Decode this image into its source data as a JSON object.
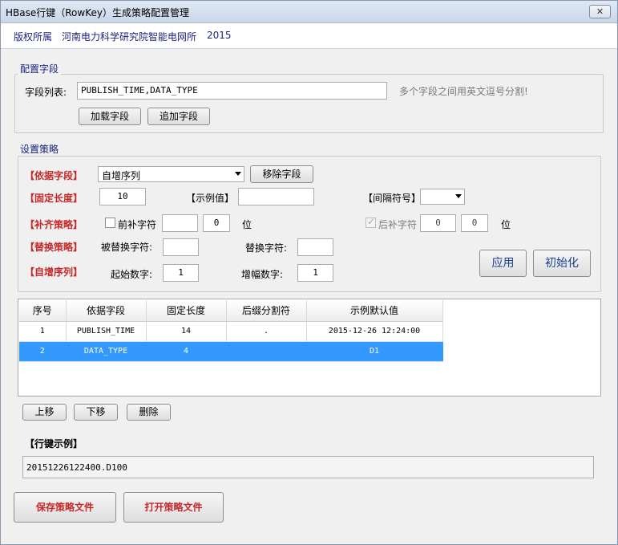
{
  "window": {
    "title": "HBase行键（RowKey）生成策略配置管理",
    "close_label": "✕"
  },
  "copyright": {
    "owner_label": "版权所属",
    "org": "河南电力科学研究院智能电网所",
    "year": "2015"
  },
  "config_fields": {
    "legend": "配置字段",
    "field_list_label": "字段列表:",
    "field_list_value": "PUBLISH_TIME,DATA_TYPE",
    "hint": "多个字段之间用英文逗号分割!",
    "load_button": "加载字段",
    "append_button": "追加字段"
  },
  "strategy": {
    "legend": "设置策略",
    "basis_label": "【依据字段】",
    "basis_select": "自增序列",
    "remove_button": "移除字段",
    "fixed_length_label": "【固定长度】",
    "fixed_length_value": "10",
    "example_label": "【示例值】",
    "example_value": "",
    "separator_label": "【间隔符号】",
    "separator_value": "",
    "pad_label": "【补齐策略】",
    "pad_prefix_label": "前补字符",
    "pad_prefix_char": "",
    "pad_prefix_count": "0",
    "pad_unit1": "位",
    "pad_suffix_label": "后补字符",
    "pad_suffix_char": "0",
    "pad_suffix_count": "0",
    "pad_unit2": "位",
    "replace_label": "【替换策略】",
    "replaced_char_label": "被替换字符:",
    "replaced_char_value": "",
    "replace_char_label": "替换字符:",
    "replace_char_value": "",
    "sequence_label": "【自增序列】",
    "start_label": "起始数字:",
    "start_value": "1",
    "step_label": "增幅数字:",
    "step_value": "1",
    "apply_button": "应用",
    "init_button": "初始化"
  },
  "table": {
    "columns": [
      "序号",
      "依据字段",
      "固定长度",
      "后缀分割符",
      "示例默认值"
    ],
    "rows": [
      [
        "1",
        "PUBLISH_TIME",
        "14",
        ".",
        "2015-12-26 12:24:00"
      ],
      [
        "2",
        "DATA_TYPE",
        "4",
        "",
        "D1"
      ]
    ]
  },
  "row_actions": {
    "up": "上移",
    "down": "下移",
    "delete": "删除"
  },
  "rowkey_example": {
    "label": "【行键示例】",
    "value": "20151226122400.D100"
  },
  "footer": {
    "save_button": "保存策略文件",
    "open_button": "打开策略文件"
  },
  "colors": {
    "accent_red": "#c62828",
    "header_blue": "#1a237e",
    "selection": "#3399ff"
  }
}
